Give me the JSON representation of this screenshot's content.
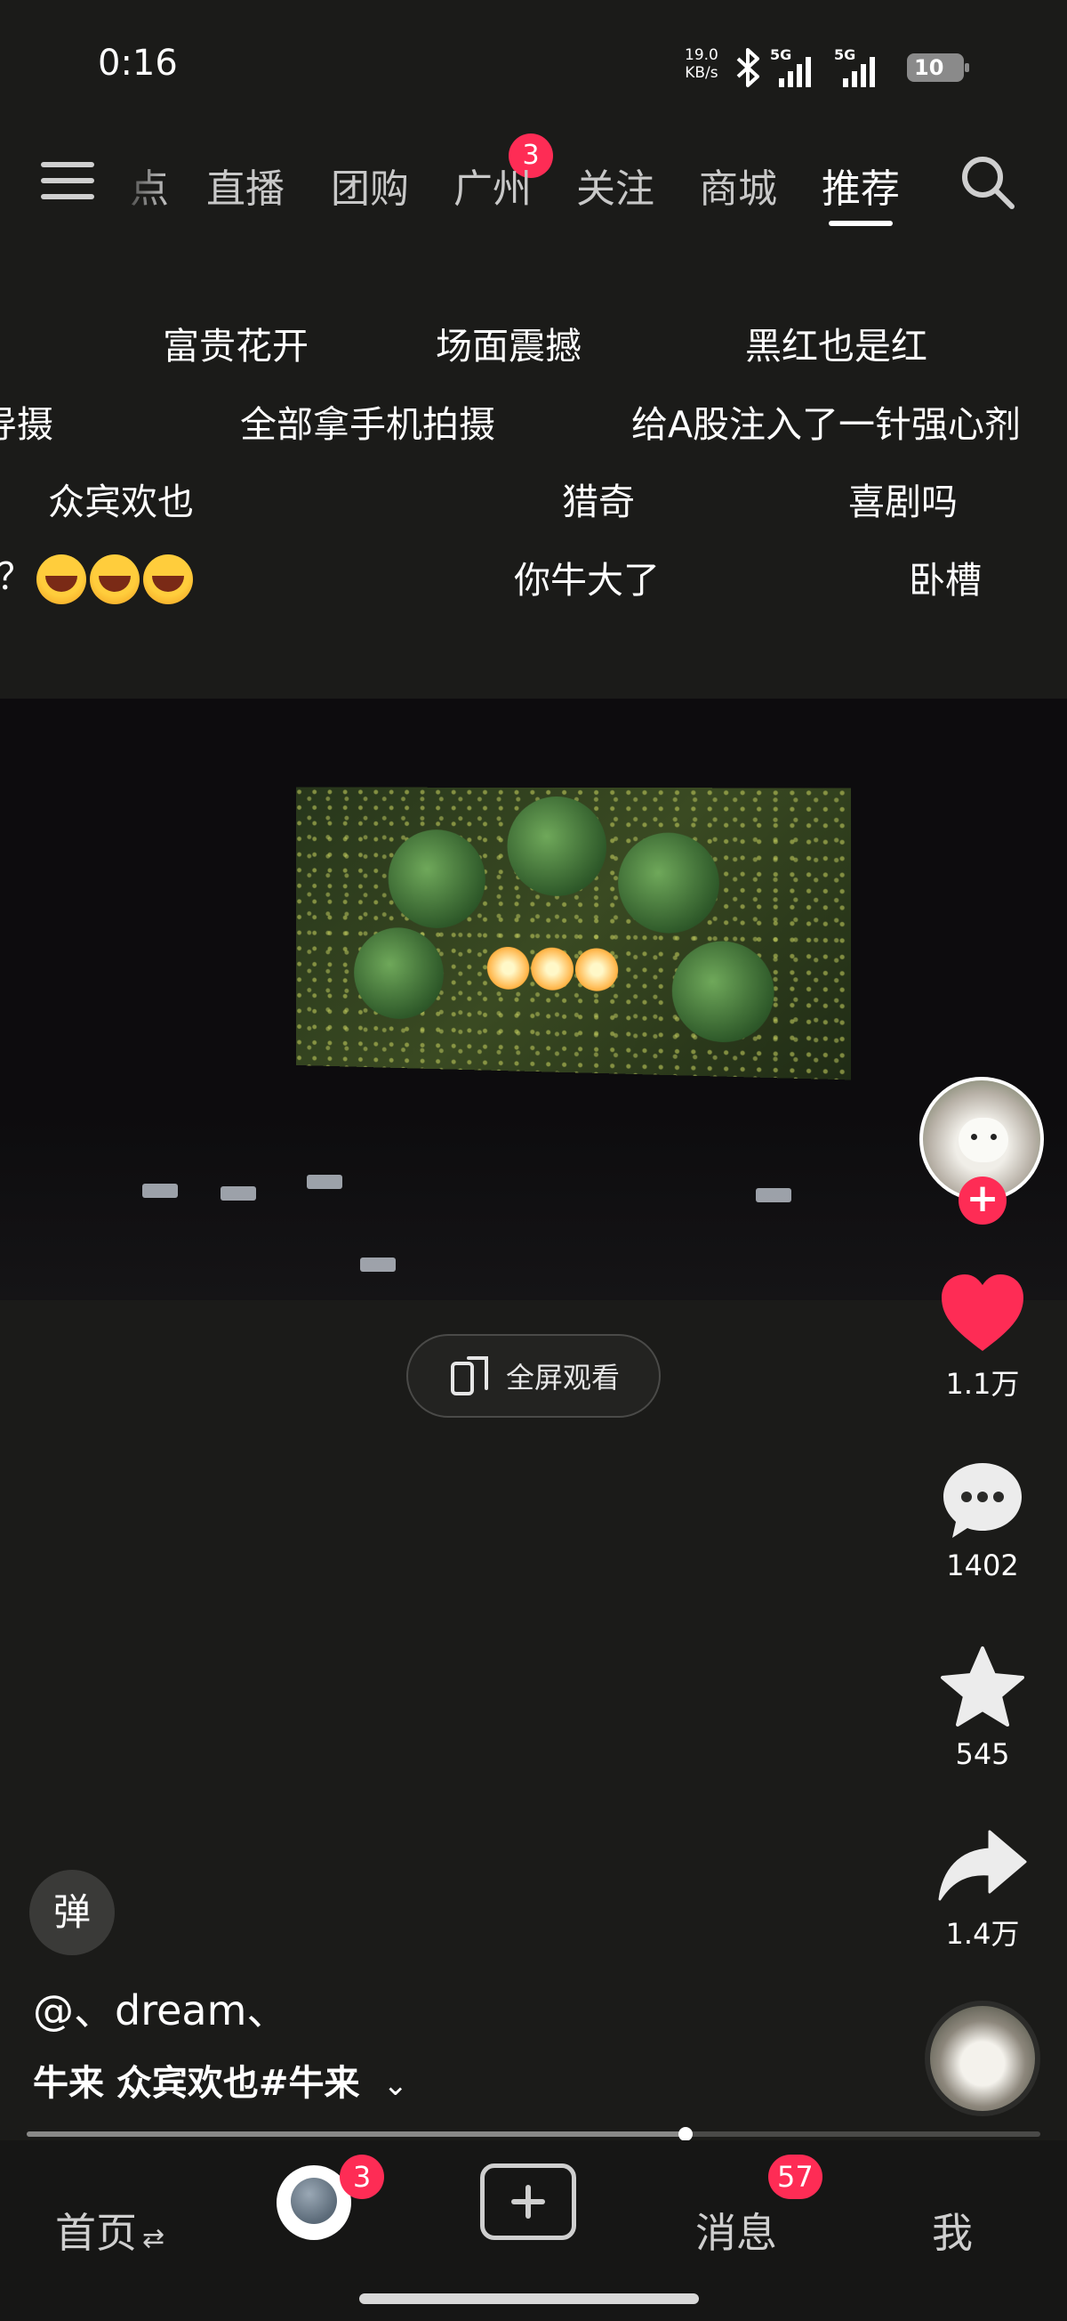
{
  "status_bar": {
    "time": "0:16",
    "net_speed_value": "19.0",
    "net_speed_unit": "KB/s",
    "sim1_type": "5G",
    "sim2_type": "5G",
    "battery_level": "10",
    "icons": [
      "bluetooth-icon",
      "signal-icon",
      "battery-icon"
    ]
  },
  "top_nav": {
    "menu_icon": "menu-icon",
    "tabs": [
      {
        "label": "点"
      },
      {
        "label": "直播"
      },
      {
        "label": "团购",
        "badge": "3"
      },
      {
        "label": "广州"
      },
      {
        "label": "关注"
      },
      {
        "label": "商城"
      },
      {
        "label": "推荐",
        "active": true
      }
    ],
    "search_icon": "search-icon"
  },
  "danmaku": [
    "富贵花开",
    "场面震撼",
    "黑红也是红",
    "导摄",
    "全部拿手机拍摄",
    "给A股注入了一针强心剂",
    "众宾欢也",
    "猎奇",
    "喜剧吗",
    "？",
    "你牛大了",
    "卧槽"
  ],
  "video": {
    "fullscreen_label": "全屏观看"
  },
  "actions": {
    "like_count": "1.1万",
    "comment_count": "1402",
    "favorite_count": "545",
    "share_count": "1.4万"
  },
  "caption": {
    "danmaku_toggle": "弹",
    "author": "@、dream、",
    "description": "牛来 众宾欢也#牛来",
    "expand_icon": "chevron-down-icon"
  },
  "progress": {
    "fraction": 0.65
  },
  "bottom_nav": {
    "home": "首页",
    "friends_badge": "3",
    "create_icon": "plus-icon",
    "messages": "消息",
    "messages_badge": "57",
    "me": "我"
  },
  "colors": {
    "accent": "#fe2c55",
    "background": "#1b1b19"
  }
}
